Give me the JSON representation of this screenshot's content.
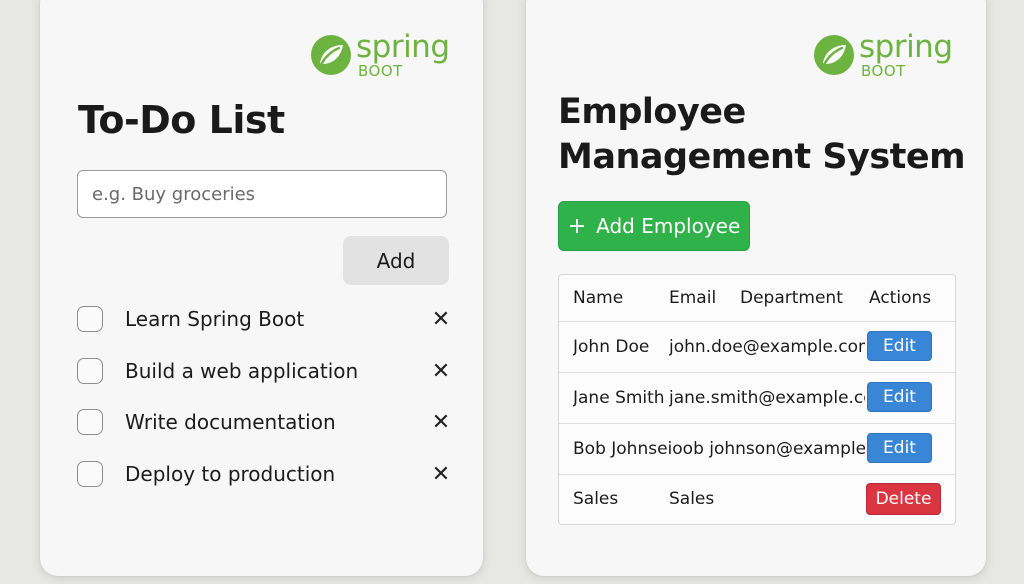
{
  "todo": {
    "logo": {
      "word": "spring",
      "sub": "BOOT"
    },
    "title": "To-Do List",
    "input_placeholder": "e.g. Buy groceries",
    "add_label": "Add",
    "remove_symbol": "✕",
    "items": [
      {
        "label": "Learn Spring Boot",
        "checked": false
      },
      {
        "label": "Build a web application",
        "checked": false
      },
      {
        "label": "Write documentation",
        "checked": false
      },
      {
        "label": "Deploy to production",
        "checked": false
      }
    ]
  },
  "employees": {
    "logo": {
      "word": "spring",
      "sub": "BOOT"
    },
    "title": "Employee Management System",
    "add_button": {
      "icon": "+",
      "label": "Add Employee"
    },
    "columns": [
      "Name",
      "Email",
      "Department",
      "Actions"
    ],
    "rows": [
      {
        "name": "John Doe",
        "email": "john.doe@example.com",
        "department": "",
        "action": "Edit"
      },
      {
        "name": "Jane Smith",
        "email": "jane.smith@example.co",
        "department": "",
        "action": "Edit"
      },
      {
        "name": "Bob Johnseioob johnson@example ›",
        "email": "",
        "department": "",
        "action": "Edit"
      },
      {
        "name": "Sales",
        "email": "Sales",
        "department": "",
        "action": "Delete"
      }
    ]
  },
  "colors": {
    "spring_green": "#6db33f",
    "add_employee_bg": "#2fb24a",
    "edit_bg": "#3a86d6",
    "delete_bg": "#d93642"
  }
}
